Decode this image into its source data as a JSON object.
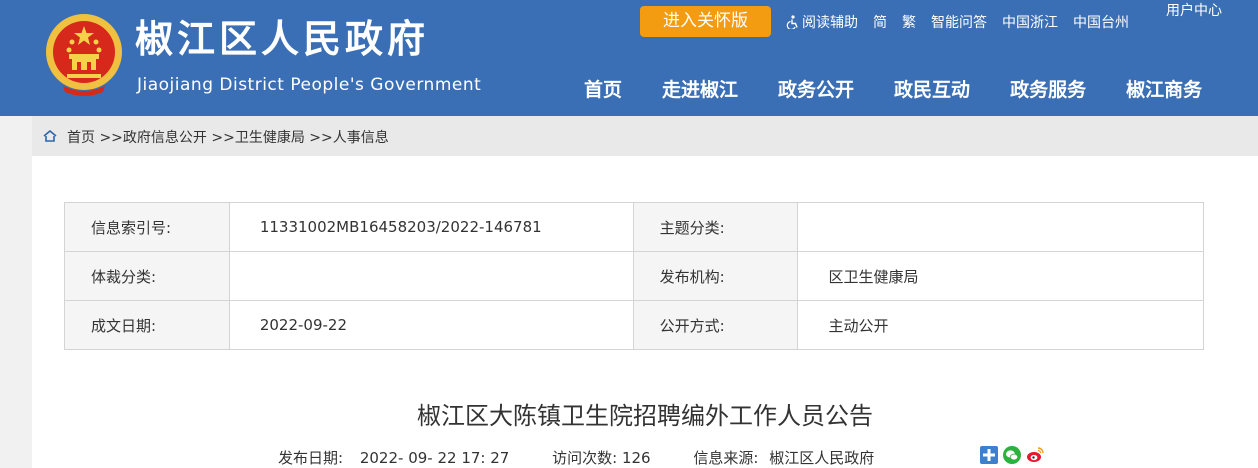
{
  "header": {
    "title": "椒江区人民政府",
    "subtitle": "Jiaojiang District People's Government",
    "care_button": "进入关怀版",
    "top_links": [
      "阅读辅助",
      "简",
      "繁",
      "智能问答",
      "中国浙江",
      "中国台州"
    ],
    "user_center": "用户中心",
    "nav": [
      "首页",
      "走进椒江",
      "政务公开",
      "政民互动",
      "政务服务",
      "椒江商务"
    ]
  },
  "breadcrumb": [
    "首页",
    ">>政府信息公开",
    ">>卫生健康局",
    ">>人事信息"
  ],
  "meta_table": {
    "index_label": "信息索引号:",
    "index_value": "11331002MB16458203/2022-146781",
    "topic_label": "主题分类:",
    "topic_value": "",
    "genre_label": "体裁分类:",
    "genre_value": "",
    "publisher_label": "发布机构:",
    "publisher_value": "区卫生健康局",
    "date_label": "成文日期:",
    "date_value": "2022-09-22",
    "mode_label": "公开方式:",
    "mode_value": "主动公开"
  },
  "article": {
    "title": "椒江区大陈镇卫生院招聘编外工作人员公告",
    "publish_label": "发布日期:",
    "publish_value": "2022- 09- 22 17: 27",
    "visits_label": "访问次数:",
    "visits_value": "126",
    "source_label": "信息来源:",
    "source_value": "椒江区人民政府"
  },
  "share_icons": [
    "share-plus-icon",
    "wechat-icon",
    "weibo-icon"
  ],
  "colors": {
    "header_bg": "#3a6fb6",
    "care_button": "#f39c12",
    "page_bg": "#f1f1f1"
  }
}
